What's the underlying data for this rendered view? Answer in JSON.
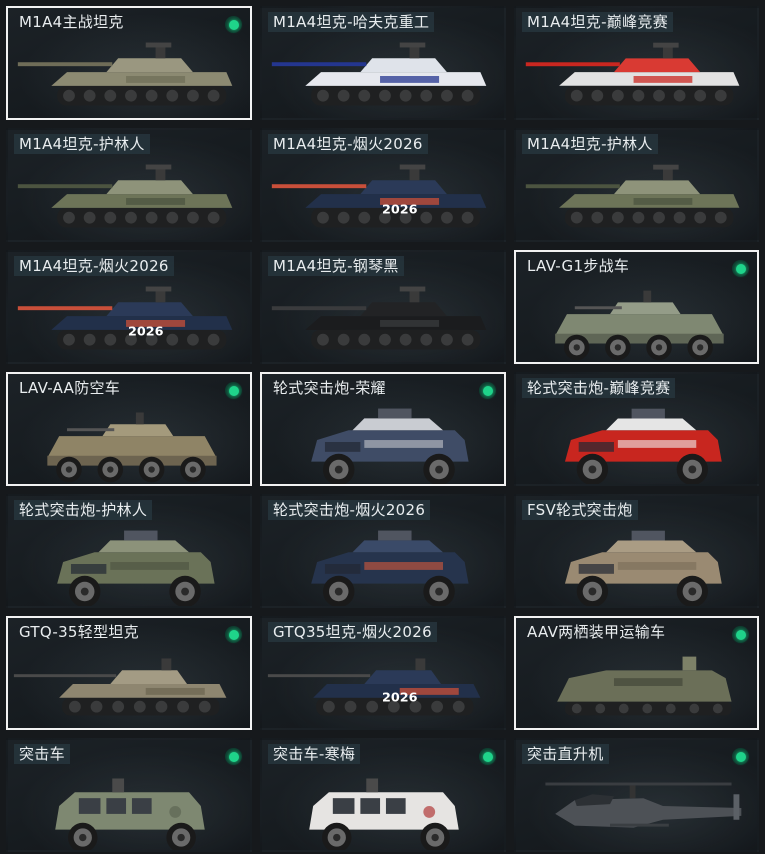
{
  "vehicles": [
    {
      "name": "M1A4主战坦克",
      "selected": true,
      "owned": true,
      "kind": "tank",
      "body": "#8c8a72",
      "turret": "#9a9780",
      "accent": "#6f6d58",
      "text": ""
    },
    {
      "name": "M1A4坦克-哈夫克重工",
      "selected": false,
      "owned": false,
      "kind": "tank",
      "body": "#e6e8ee",
      "turret": "#dfe3ea",
      "accent": "#24368f",
      "text": ""
    },
    {
      "name": "M1A4坦克-巅峰竞赛",
      "selected": false,
      "owned": false,
      "kind": "tank",
      "body": "#e2e2e2",
      "turret": "#d93a33",
      "accent": "#c92720",
      "text": ""
    },
    {
      "name": "M1A4坦克-护林人",
      "selected": false,
      "owned": false,
      "kind": "tank",
      "body": "#6d7458",
      "turret": "#8e937a",
      "accent": "#4c5440",
      "text": ""
    },
    {
      "name": "M1A4坦克-烟火2026",
      "selected": false,
      "owned": false,
      "kind": "tank",
      "body": "#22304a",
      "turret": "#2b3a58",
      "accent": "#c94f3a",
      "text": "2026"
    },
    {
      "name": "M1A4坦克-护林人",
      "selected": false,
      "owned": false,
      "kind": "tank",
      "body": "#6d7458",
      "turret": "#8e937a",
      "accent": "#4c5440",
      "text": ""
    },
    {
      "name": "M1A4坦克-烟火2026",
      "selected": false,
      "owned": false,
      "kind": "tank",
      "body": "#22304a",
      "turret": "#2b3a58",
      "accent": "#c94f3a",
      "text": "2026"
    },
    {
      "name": "M1A4坦克-钢琴黑",
      "selected": false,
      "owned": false,
      "kind": "tank",
      "body": "#1b1c1e",
      "turret": "#222325",
      "accent": "#3a3b3d",
      "text": ""
    },
    {
      "name": "LAV-G1步战车",
      "selected": true,
      "owned": true,
      "kind": "apc",
      "body": "#7f8872",
      "turret": "#949c88",
      "accent": "#5f6656",
      "text": ""
    },
    {
      "name": "LAV-AA防空车",
      "selected": true,
      "owned": true,
      "kind": "apc",
      "body": "#8f8466",
      "turret": "#a49a7c",
      "accent": "#6d6450",
      "text": ""
    },
    {
      "name": "轮式突击炮-荣耀",
      "selected": true,
      "owned": true,
      "kind": "car",
      "body": "#3f4c66",
      "turret": "#c9ccd2",
      "accent": "#c4c7cc",
      "text": ""
    },
    {
      "name": "轮式突击炮-巅峰竞赛",
      "selected": false,
      "owned": false,
      "kind": "car",
      "body": "#c8261f",
      "turret": "#e5e5e5",
      "accent": "#f0f0f0",
      "text": ""
    },
    {
      "name": "轮式突击炮-护林人",
      "selected": false,
      "owned": false,
      "kind": "car",
      "body": "#6a7258",
      "turret": "#8c927a",
      "accent": "#4b5240",
      "text": ""
    },
    {
      "name": "轮式突击炮-烟火2026",
      "selected": false,
      "owned": false,
      "kind": "car",
      "body": "#26344d",
      "turret": "#3a4a68",
      "accent": "#d65a3c",
      "text": ""
    },
    {
      "name": "FSV轮式突击炮",
      "selected": false,
      "owned": false,
      "kind": "car",
      "body": "#9a8a72",
      "turret": "#aa9c84",
      "accent": "#7a6c58",
      "text": ""
    },
    {
      "name": "GTQ-35轻型坦克",
      "selected": true,
      "owned": true,
      "kind": "light",
      "body": "#8e8670",
      "turret": "#a39b84",
      "accent": "#6c6552",
      "text": ""
    },
    {
      "name": "GTQ35坦克-烟火2026",
      "selected": false,
      "owned": false,
      "kind": "light",
      "body": "#22304a",
      "turret": "#2b3a58",
      "accent": "#c94f3a",
      "text": "2026"
    },
    {
      "name": "AAV两栖装甲运输车",
      "selected": true,
      "owned": true,
      "kind": "aav",
      "body": "#6b6f58",
      "turret": "#7d8168",
      "accent": "#4f5342",
      "text": ""
    },
    {
      "name": "突击车",
      "selected": false,
      "owned": true,
      "kind": "mrap",
      "body": "#7e8871",
      "turret": "#8f9882",
      "accent": "#5e6654",
      "text": ""
    },
    {
      "name": "突击车-寒梅",
      "selected": false,
      "owned": true,
      "kind": "mrap",
      "body": "#e6e4e2",
      "turret": "#f1efed",
      "accent": "#b13a3a",
      "text": ""
    },
    {
      "name": "突击直升机",
      "selected": false,
      "owned": true,
      "kind": "heli",
      "body": "#4d5156",
      "turret": "#5b6066",
      "accent": "#3a3e42",
      "text": ""
    }
  ]
}
